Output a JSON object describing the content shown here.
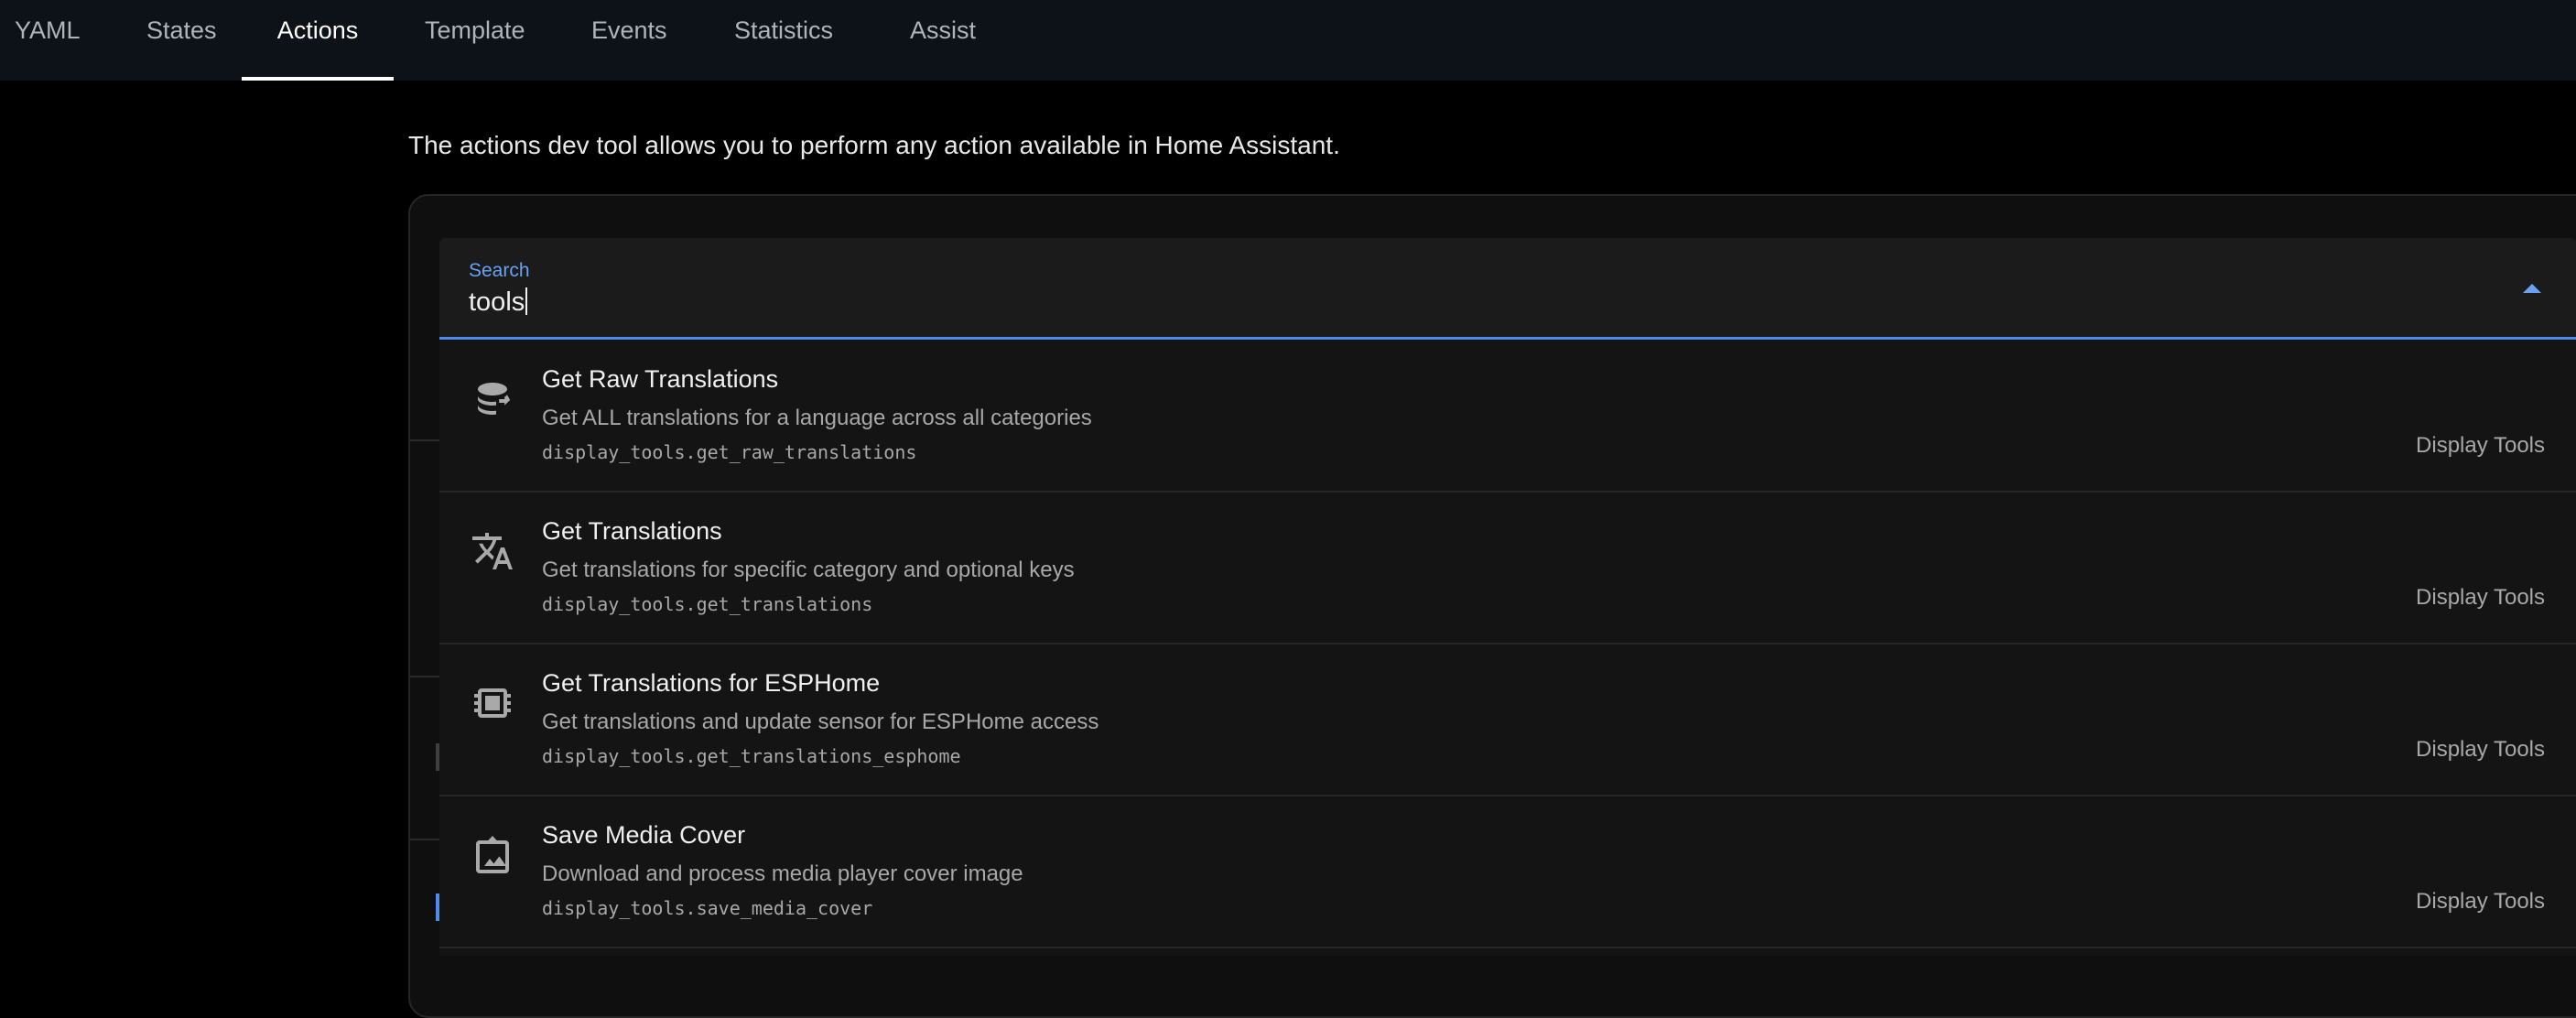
{
  "tabs": [
    {
      "label": "YAML"
    },
    {
      "label": "States"
    },
    {
      "label": "Actions"
    },
    {
      "label": "Template"
    },
    {
      "label": "Events"
    },
    {
      "label": "Statistics"
    },
    {
      "label": "Assist"
    }
  ],
  "active_tab": "Actions",
  "intro_text": "The actions dev tool allows you to perform any action available in Home Assistant.",
  "search": {
    "label": "Search",
    "value": "tools"
  },
  "results": [
    {
      "title": "Get Raw Translations",
      "description": "Get ALL translations for a language across all categories",
      "action_id": "display_tools.get_raw_translations",
      "domain": "Display Tools",
      "icon": "database-arrow-right-icon"
    },
    {
      "title": "Get Translations",
      "description": "Get translations for specific category and optional keys",
      "action_id": "display_tools.get_translations",
      "domain": "Display Tools",
      "icon": "translate-icon"
    },
    {
      "title": "Get Translations for ESPHome",
      "description": "Get translations and update sensor for ESPHome access",
      "action_id": "display_tools.get_translations_esphome",
      "domain": "Display Tools",
      "icon": "chip-icon"
    },
    {
      "title": "Save Media Cover",
      "description": "Download and process media player cover image",
      "action_id": "display_tools.save_media_cover",
      "domain": "Display Tools",
      "icon": "image-frame-icon"
    }
  ],
  "colors": {
    "accent": "#4c8dec",
    "background": "#000000",
    "topbar": "#0d1118"
  }
}
